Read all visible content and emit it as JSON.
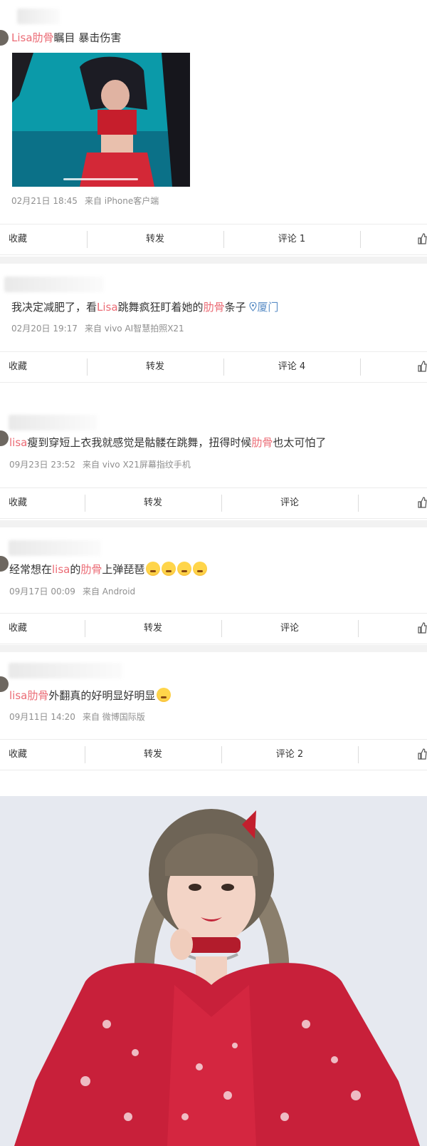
{
  "posts": [
    {
      "segments": [
        {
          "t": "Lisa肋骨",
          "hl": true
        },
        {
          "t": "瞩目 暴击伤害",
          "hl": false
        }
      ],
      "date": "02月21日 18:45",
      "source": "来自 iPhone客户端",
      "actions": {
        "fav": "收藏",
        "repost": "转发",
        "comment": "评论 1"
      }
    },
    {
      "segments": [
        {
          "t": "我决定减肥了，看",
          "hl": false
        },
        {
          "t": "Lisa",
          "hl": true
        },
        {
          "t": "跳舞疯狂盯着她的",
          "hl": false
        },
        {
          "t": "肋骨",
          "hl": true
        },
        {
          "t": "条子 ",
          "hl": false
        }
      ],
      "location": "厦门",
      "date": "02月20日 19:17",
      "source": "来自 vivo AI智慧拍照X21",
      "actions": {
        "fav": "收藏",
        "repost": "转发",
        "comment": "评论 4"
      }
    },
    {
      "segments": [
        {
          "t": "lisa",
          "hl": true
        },
        {
          "t": "瘦到穿短上衣我就感觉是骷髅在跳舞，扭得时候",
          "hl": false
        },
        {
          "t": "肋骨",
          "hl": true
        },
        {
          "t": "也太可怕了",
          "hl": false
        }
      ],
      "date": "09月23日 23:52",
      "source": "来自 vivo X21屏幕指纹手机",
      "actions": {
        "fav": "收藏",
        "repost": "转发",
        "comment": "评论"
      }
    },
    {
      "segments": [
        {
          "t": "经常想在",
          "hl": false
        },
        {
          "t": "lisa",
          "hl": true
        },
        {
          "t": "的",
          "hl": false
        },
        {
          "t": "肋骨",
          "hl": true
        },
        {
          "t": "上弹琵琶",
          "hl": false
        }
      ],
      "emoji_count": 4,
      "date": "09月17日 00:09",
      "source": "来自 Android",
      "actions": {
        "fav": "收藏",
        "repost": "转发",
        "comment": "评论"
      }
    },
    {
      "segments": [
        {
          "t": "lisa肋骨",
          "hl": true
        },
        {
          "t": "外翻真的好明显好明显",
          "hl": false
        }
      ],
      "emoji_count": 1,
      "date": "09月11日 14:20",
      "source": "来自 微博国际版",
      "actions": {
        "fav": "收藏",
        "repost": "转发",
        "comment": "评论 2"
      }
    }
  ],
  "icons": {
    "like": "thumbs-up-icon",
    "location": "location-pin-icon",
    "emoji": "crying-laughing-emoji-icon"
  },
  "colors": {
    "highlight": "#eb6b75",
    "location": "#5b8ec6",
    "meta": "#8f8f8f",
    "separator": "#f2f2f2"
  }
}
